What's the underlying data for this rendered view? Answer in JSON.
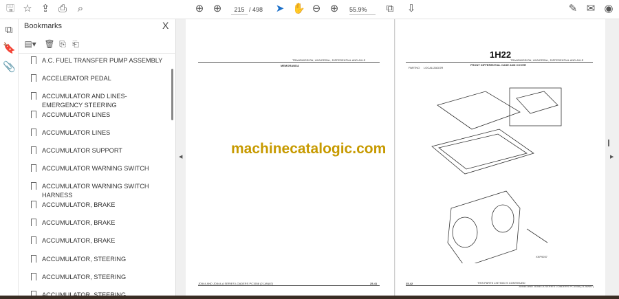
{
  "toolbar": {
    "page_current": "215",
    "page_total": "/ 498",
    "zoom": "55.9%"
  },
  "bookmarks": {
    "title": "Bookmarks",
    "close": "X",
    "items": [
      "A.C. FUEL TRANSFER PUMP ASSEMBLY",
      "ACCELERATOR PEDAL",
      "ACCUMULATOR AND LINES-EMERGENCY STEERING",
      "ACCUMULATOR LINES",
      "ACCUMULATOR LINES",
      "ACCUMULATOR SUPPORT",
      "ACCUMULATOR WARNING SWITCH",
      "ACCUMULATOR WARNING SWITCH HARNESS",
      "ACCUMULATOR, BRAKE",
      "ACCUMULATOR, BRAKE",
      "ACCUMULATOR, BRAKE",
      "ACCUMULATOR, STEERING",
      "ACCUMULATOR, STEERING",
      "ACCUMULATOR, STEERING"
    ]
  },
  "left_page": {
    "header": "TRANSMISSION, UNIVERSAL, DIFFERENTIAL AND AXLE",
    "subheader": "MEMORANDA",
    "footer": "JD544 AND JD544-A SERIES LOADERS   PC1558   (21JAN87)",
    "page_no": "25-41"
  },
  "right_page": {
    "code": "1H22",
    "header": "TRANSMISSION, UNIVERSAL, DIFFERENTIAL AND AXLE",
    "subheader": "FRONT DIFFERENTIAL CASE AND COVER",
    "ref1": "PARTNO",
    "ref2": "LOCALIZADOR",
    "fig": "XKP9257",
    "continued": "THIS PARTS LISTING IS CONTINUED",
    "footer": "JD544 AND JD544-A SERIES LOADERS   PC1558   (21JAN87)",
    "page_no": "25-42"
  },
  "watermark": "machinecatalogic.com"
}
